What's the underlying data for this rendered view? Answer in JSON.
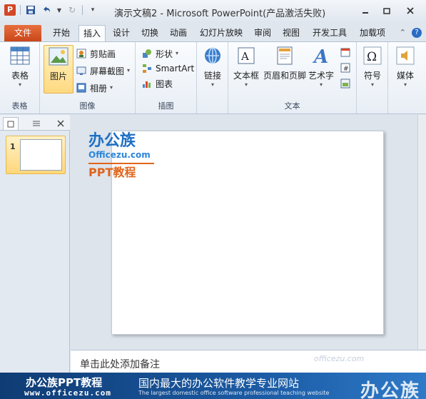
{
  "window": {
    "title": "演示文稿2 - Microsoft PowerPoint(产品激活失败)",
    "app_icon_letter": "P"
  },
  "qat": {
    "save_icon": "save-icon",
    "undo_icon": "undo-icon",
    "redo_icon": "redo-icon",
    "customize_icon": "customize-qat-icon"
  },
  "tabs": [
    {
      "label": "文件"
    },
    {
      "label": "开始"
    },
    {
      "label": "插入"
    },
    {
      "label": "设计"
    },
    {
      "label": "切换"
    },
    {
      "label": "动画"
    },
    {
      "label": "幻灯片放映"
    },
    {
      "label": "审阅"
    },
    {
      "label": "视图"
    },
    {
      "label": "开发工具"
    },
    {
      "label": "加载项"
    }
  ],
  "ribbon": {
    "groups": {
      "table": {
        "label": "表格",
        "button": "表格"
      },
      "images": {
        "label": "图像",
        "picture": "图片",
        "clipart": "剪贴画",
        "screenshot": "屏幕截图",
        "album": "相册"
      },
      "illustrations": {
        "label": "插图",
        "shapes": "形状",
        "smartart": "SmartArt",
        "chart": "图表"
      },
      "links": {
        "label": "",
        "link": "链接"
      },
      "text": {
        "label": "文本",
        "textbox": "文本框",
        "header_footer": "页眉和页脚",
        "wordart": "艺术字"
      },
      "symbols": {
        "label": "",
        "symbol": "符号"
      },
      "media": {
        "label": "",
        "media": "媒体"
      }
    }
  },
  "slides_panel": {
    "slide_number": "1"
  },
  "notes": {
    "placeholder": "单击此处添加备注"
  },
  "watermark": {
    "brand": "办公族",
    "url": "Officezu.com",
    "subtitle": "PPT教程"
  },
  "banner": {
    "title": "办公族PPT教程",
    "url": "www.officezu.com",
    "tagline": "国内最大的办公软件教学专业网站",
    "tagline_en": "The largest domestic office software professional teaching website",
    "logo_text": "办公族"
  },
  "corner_watermark": "officezu.com",
  "colors": {
    "file_tab": "#d24726",
    "accent": "#2b579a",
    "banner": "#1b5aa3",
    "selected_button": "#ffd980"
  }
}
